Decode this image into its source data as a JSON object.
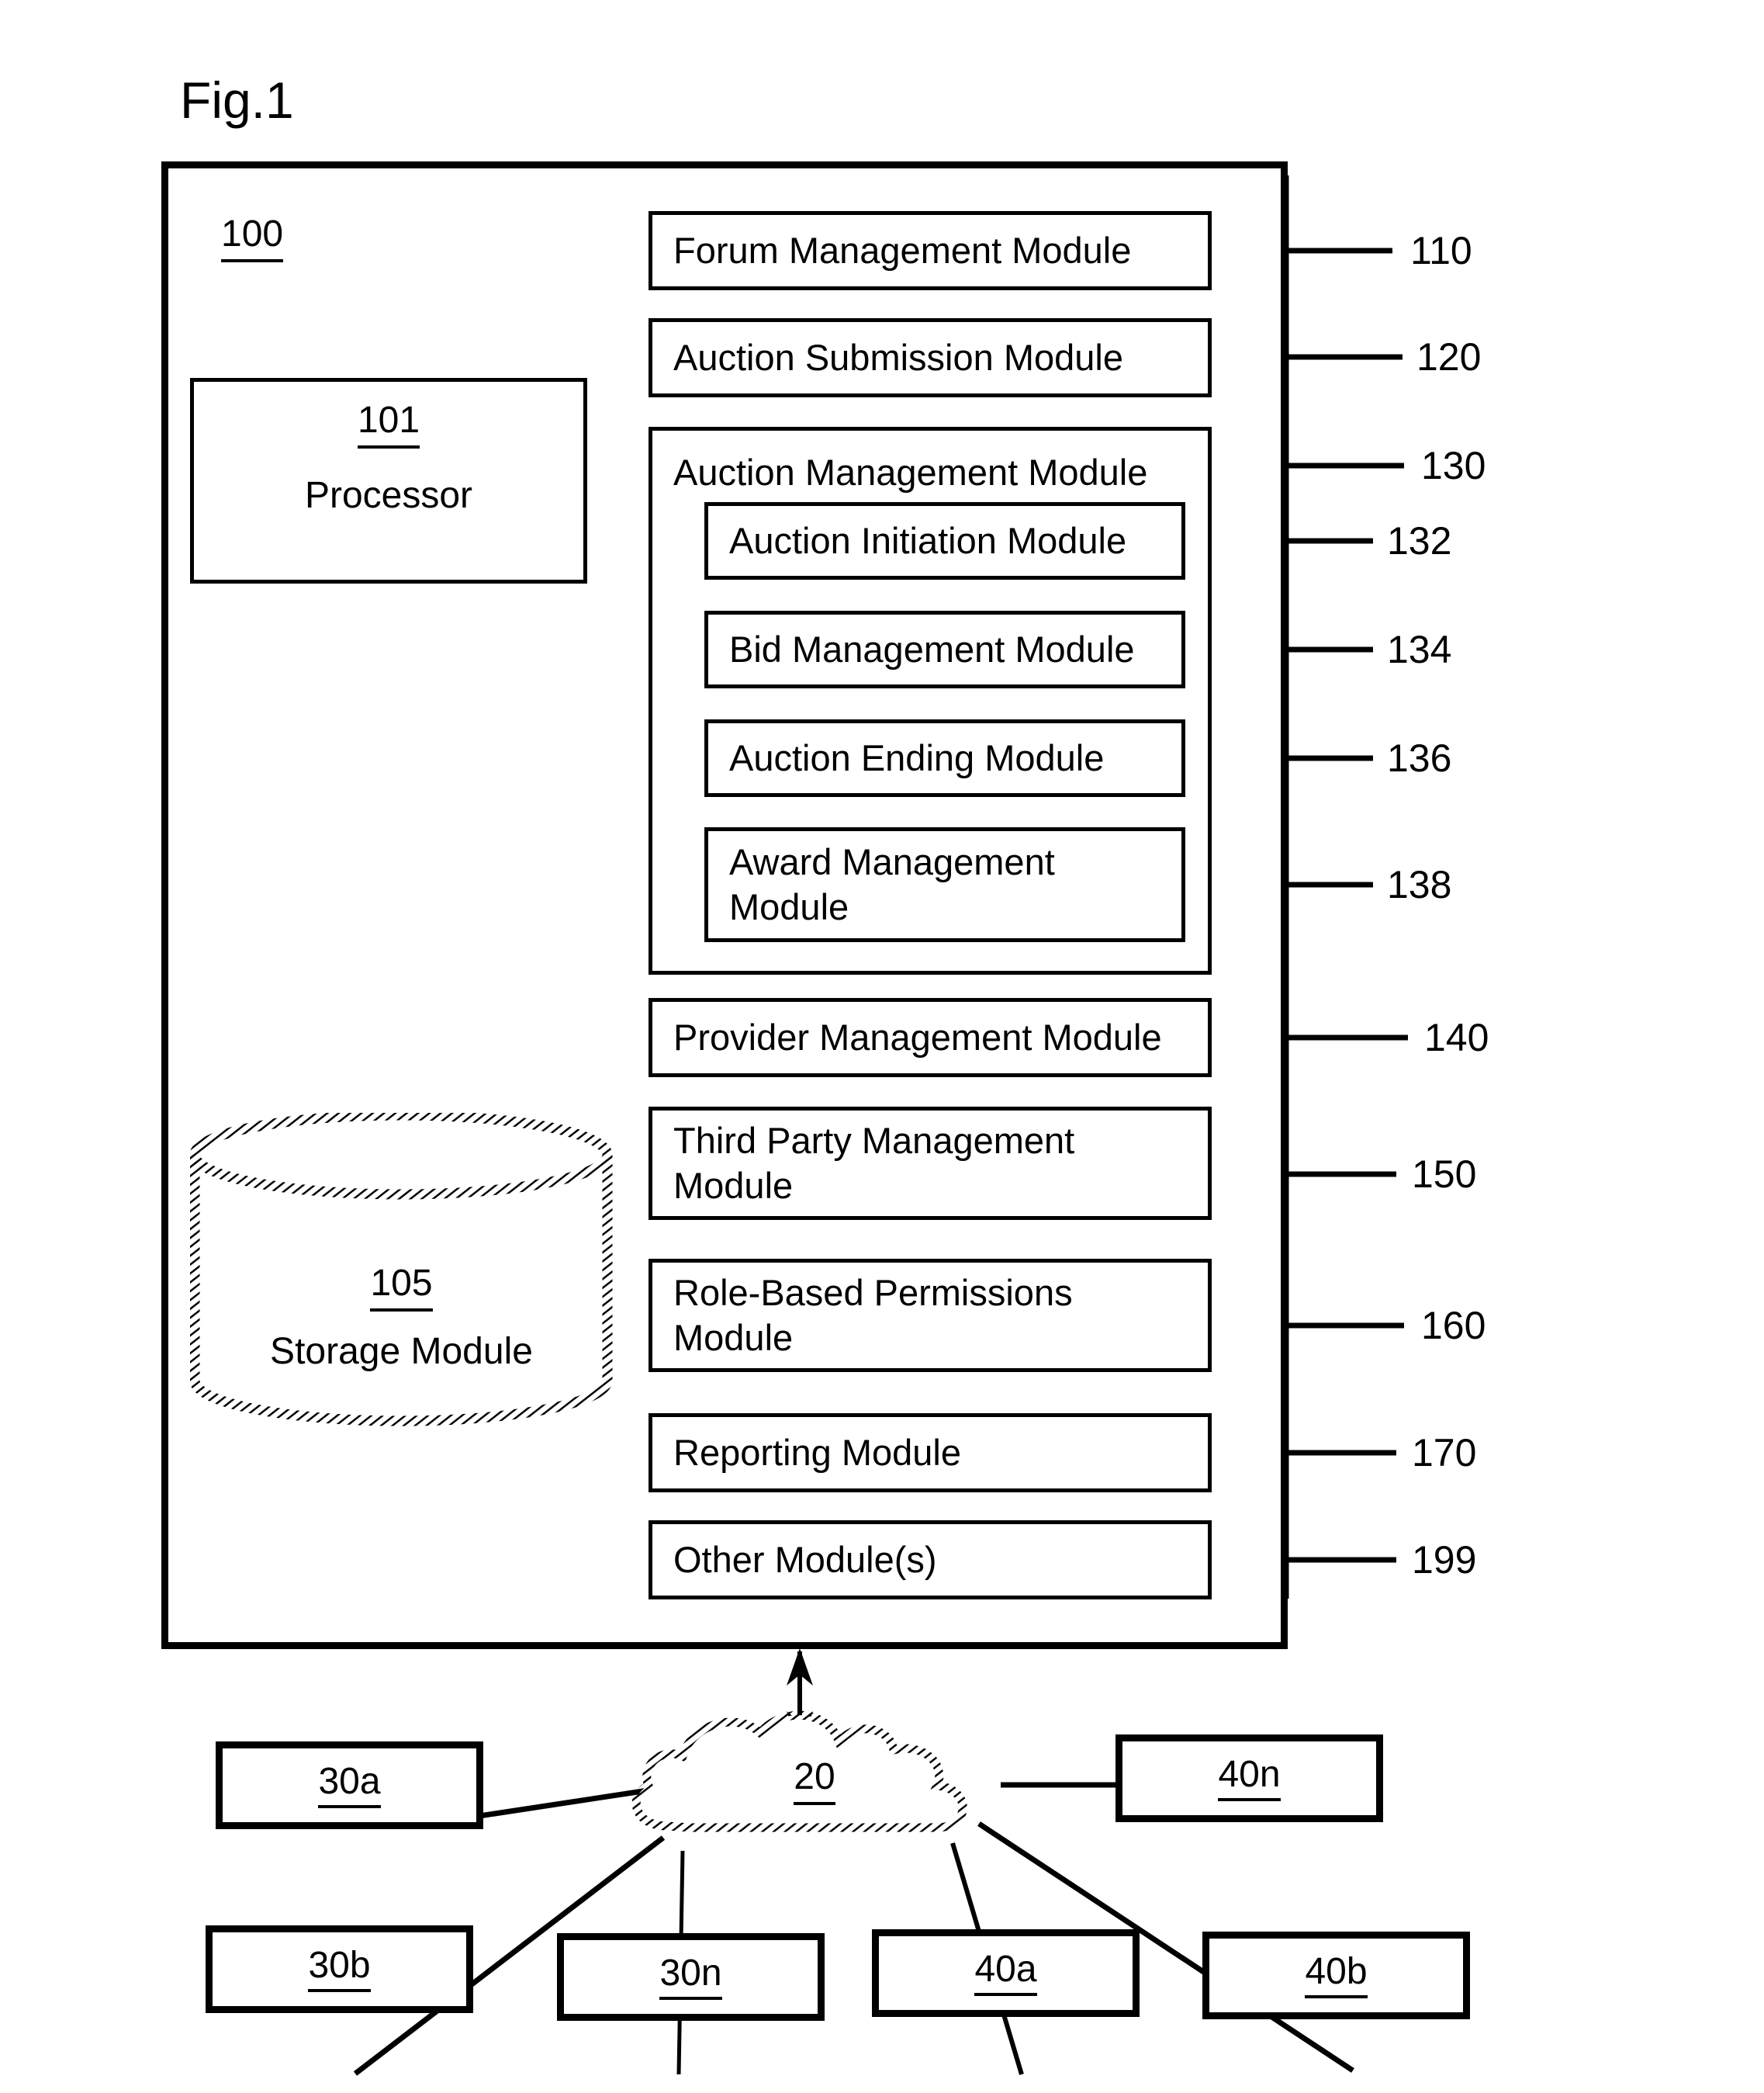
{
  "figure": {
    "title": "Fig.1",
    "system_label": "100"
  },
  "system": {
    "processor": {
      "number": "101",
      "name": "Processor"
    },
    "storage": {
      "number": "105",
      "name": "Storage Module"
    },
    "modules": [
      {
        "label": "Forum Management Module",
        "ref": "110"
      },
      {
        "label": "Auction Submission Module",
        "ref": "120"
      },
      {
        "label": "Auction Management Module",
        "ref": "130"
      },
      {
        "label": "Provider Management Module",
        "ref": "140"
      },
      {
        "label": "Third Party Management Module",
        "ref": "150"
      },
      {
        "label": "Role-Based Permissions Module",
        "ref": "160"
      },
      {
        "label": "Reporting Module",
        "ref": "170"
      },
      {
        "label": "Other Module(s)",
        "ref": "199"
      }
    ],
    "submodules": [
      {
        "label": "Auction Initiation Module",
        "ref": "132"
      },
      {
        "label": "Bid Management Module",
        "ref": "134"
      },
      {
        "label": "Auction Ending Module",
        "ref": "136"
      },
      {
        "label": "Award Management Module",
        "ref": "138"
      }
    ]
  },
  "network": {
    "cloud_label": "20"
  },
  "terminals": [
    {
      "label": "30a"
    },
    {
      "label": "30b"
    },
    {
      "label": "30n"
    },
    {
      "label": "40a"
    },
    {
      "label": "40b"
    },
    {
      "label": "40n"
    }
  ],
  "colors": {
    "line": "#000000",
    "background": "#ffffff"
  }
}
